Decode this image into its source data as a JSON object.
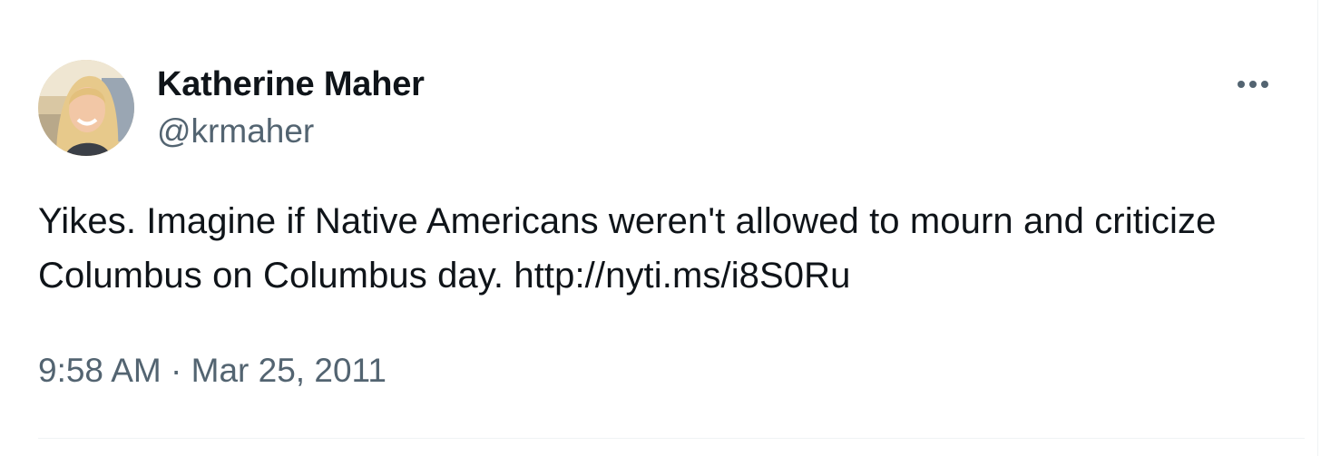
{
  "author": {
    "display_name": "Katherine Maher",
    "handle": "@krmaher"
  },
  "more_icon": "more-horizontal-icon",
  "tweet": {
    "text": "Yikes. Imagine if Native Americans weren't allowed to mourn and criticize Columbus on Columbus day. ",
    "link": "http://nyti.ms/i8S0Ru"
  },
  "meta": {
    "time": "9:58 AM",
    "separator": " · ",
    "date": "Mar 25, 2011"
  },
  "colors": {
    "primary_text": "#0f1419",
    "secondary_text": "#536471",
    "divider": "#eff3f4"
  }
}
